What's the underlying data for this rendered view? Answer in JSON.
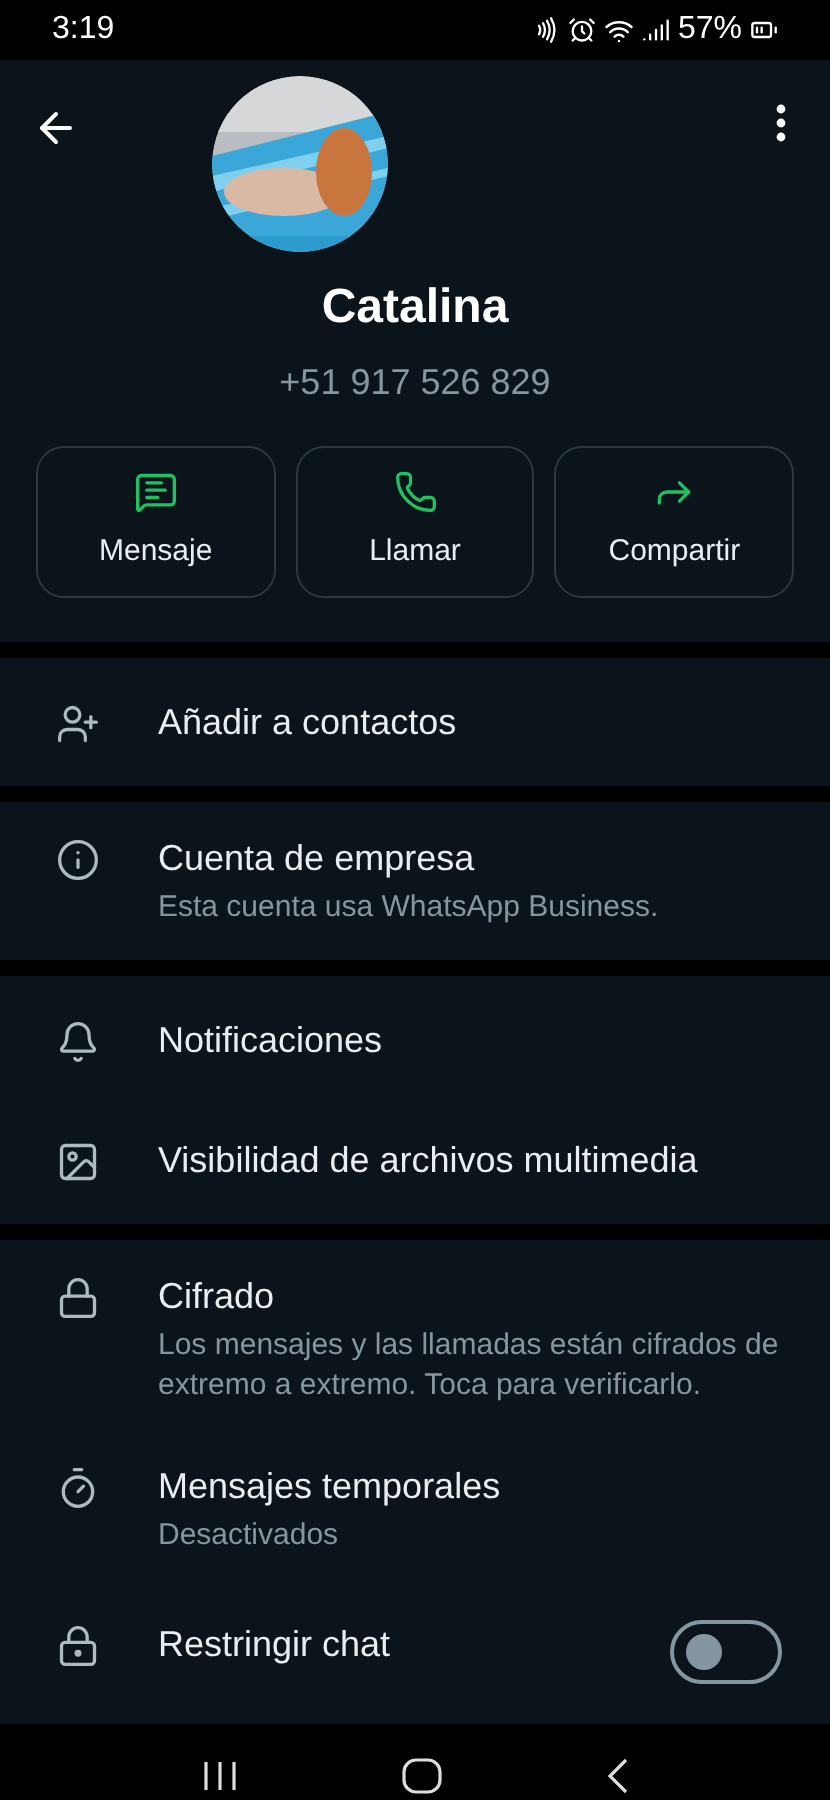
{
  "status_bar": {
    "time": "3:19",
    "battery": "57%"
  },
  "contact": {
    "name": "Catalina",
    "phone": "+51 917 526 829"
  },
  "actions": [
    {
      "label": "Mensaje"
    },
    {
      "label": "Llamar"
    },
    {
      "label": "Compartir"
    }
  ],
  "sections": [
    {
      "items": [
        {
          "kind": "plain",
          "title": "Añadir a contactos"
        }
      ]
    },
    {
      "items": [
        {
          "kind": "plain",
          "title": "Cuenta de empresa",
          "subtitle": "Esta cuenta usa WhatsApp Business."
        }
      ]
    },
    {
      "items": [
        {
          "kind": "plain",
          "title": "Notificaciones"
        },
        {
          "kind": "plain",
          "title": "Visibilidad de archivos multimedia"
        }
      ]
    },
    {
      "items": [
        {
          "kind": "plain",
          "title": "Cifrado",
          "subtitle": "Los mensajes y las llamadas están cifrados de extremo a extremo. Toca para verificarlo."
        },
        {
          "kind": "plain",
          "title": "Mensajes temporales",
          "subtitle": "Desactivados"
        },
        {
          "kind": "toggle",
          "title": "Restringir chat",
          "on": false
        }
      ]
    }
  ]
}
